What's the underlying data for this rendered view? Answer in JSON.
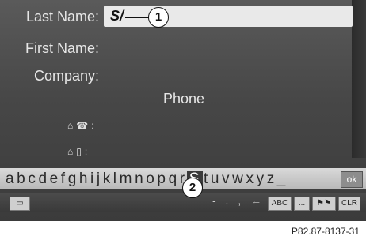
{
  "form": {
    "last_name_label": "Last Name:",
    "last_name_value": "S/",
    "first_name_label": "First Name:",
    "company_label": "Company:",
    "phone_heading": "Phone",
    "phone_home_icon": "home-phone-icon",
    "phone_home_suffix": ":",
    "mobile_home_icon": "home-mobile-icon",
    "mobile_home_suffix": ":"
  },
  "keyboard": {
    "characters": [
      "a",
      "b",
      "c",
      "d",
      "e",
      "f",
      "g",
      "h",
      "i",
      "j",
      "k",
      "l",
      "m",
      "n",
      "o",
      "p",
      "q",
      "r",
      "S",
      "t",
      "u",
      "v",
      "w",
      "x",
      "y",
      "z",
      "_"
    ],
    "selected": "S",
    "ok_label": "ok"
  },
  "bottom_bar": {
    "menu_icon": "menu-icon",
    "symbols": "- . , ← ↓",
    "abc_label": "ABC",
    "dots_label": "...",
    "clr_label": "CLR"
  },
  "callouts": {
    "one": "1",
    "two": "2"
  },
  "image_code": "P82.87-8137-31"
}
